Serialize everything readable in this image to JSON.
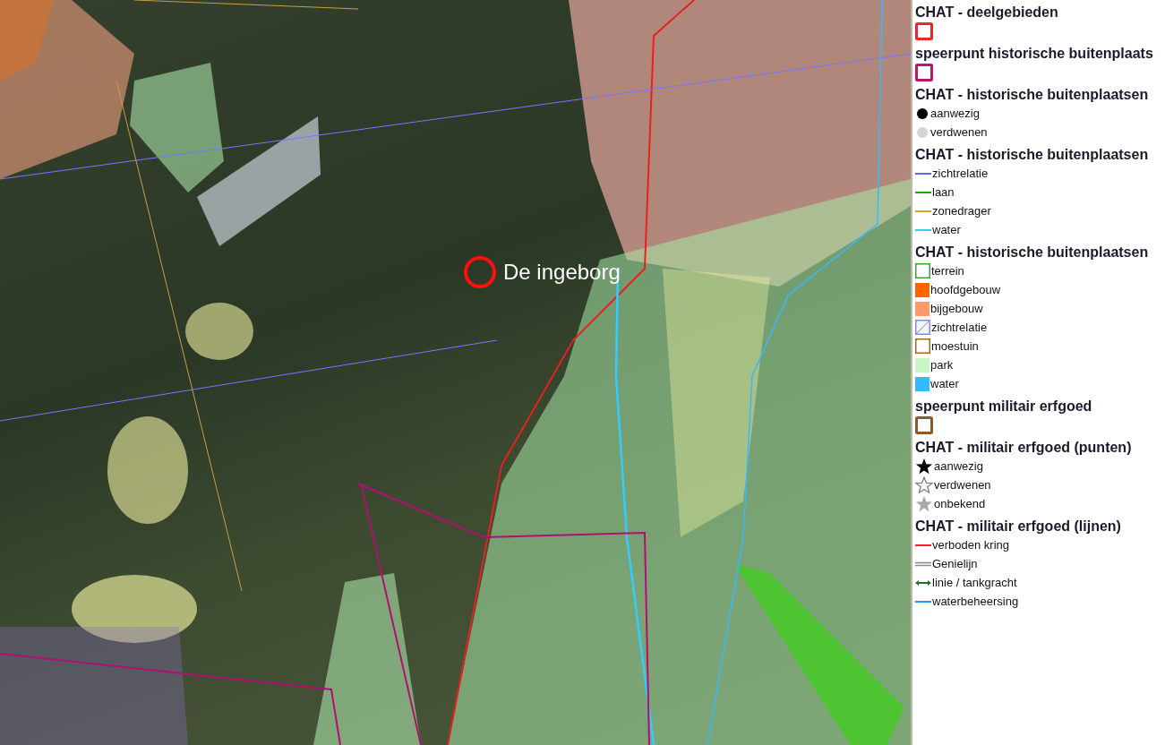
{
  "map": {
    "place_label": "De ingeborg"
  },
  "legend": [
    {
      "title": "CHAT - deelgebieden",
      "items": [
        {
          "kind": "outline",
          "color": "#e8262b"
        }
      ]
    },
    {
      "title": "speerpunt historische buitenplaats",
      "items": [
        {
          "kind": "outline",
          "color": "#c0136f"
        }
      ]
    },
    {
      "title": "CHAT - historische buitenplaatsen",
      "items": [
        {
          "kind": "dot",
          "color": "#000000",
          "label": "aanwezig"
        },
        {
          "kind": "dot",
          "color": "#d4d4d4",
          "label": "verdwenen"
        }
      ]
    },
    {
      "title": "CHAT - historische buitenplaatsen",
      "items": [
        {
          "kind": "line",
          "color": "#6666dd",
          "label": "zichtrelatie"
        },
        {
          "kind": "line",
          "color": "#2a9a2a",
          "label": "laan"
        },
        {
          "kind": "line",
          "color": "#e0a030",
          "label": "zonedrager"
        },
        {
          "kind": "line",
          "color": "#33ccff",
          "label": "water"
        }
      ]
    },
    {
      "title": "CHAT - historische buitenplaatsen",
      "items": [
        {
          "kind": "square-outline",
          "color": "#33aa33",
          "label": "terrein"
        },
        {
          "kind": "square",
          "color": "#ff6600",
          "label": "hoofdgebouw"
        },
        {
          "kind": "square",
          "color": "#ff9966",
          "label": "bijgebouw"
        },
        {
          "kind": "hatch",
          "color": "#8888ee",
          "label": "zichtrelatie"
        },
        {
          "kind": "square-outline",
          "color": "#a06a20",
          "label": "moestuin"
        },
        {
          "kind": "square",
          "color": "#c8f5c8",
          "label": "park"
        },
        {
          "kind": "square",
          "color": "#33bbff",
          "label": "water"
        }
      ]
    },
    {
      "title": "speerpunt militair erfgoed",
      "items": [
        {
          "kind": "outline",
          "color": "#8b5a2b"
        }
      ]
    },
    {
      "title": "CHAT - militair erfgoed (punten)",
      "items": [
        {
          "kind": "star",
          "color": "#000000",
          "label": "aanwezig"
        },
        {
          "kind": "star-outline",
          "color": "#777777",
          "label": "verdwenen"
        },
        {
          "kind": "star",
          "color": "#aaaaaa",
          "label": "onbekend"
        }
      ]
    },
    {
      "title": "CHAT - militair erfgoed (lijnen)",
      "items": [
        {
          "kind": "line",
          "color": "#ff2020",
          "label": "verboden kring"
        },
        {
          "kind": "double-line",
          "color": "#888888",
          "label": "Genielijn"
        },
        {
          "kind": "arrow-line",
          "color": "#2e6b2e",
          "label": "linie / tankgracht"
        },
        {
          "kind": "line",
          "color": "#2299ee",
          "label": "waterbeheersing"
        }
      ]
    }
  ]
}
